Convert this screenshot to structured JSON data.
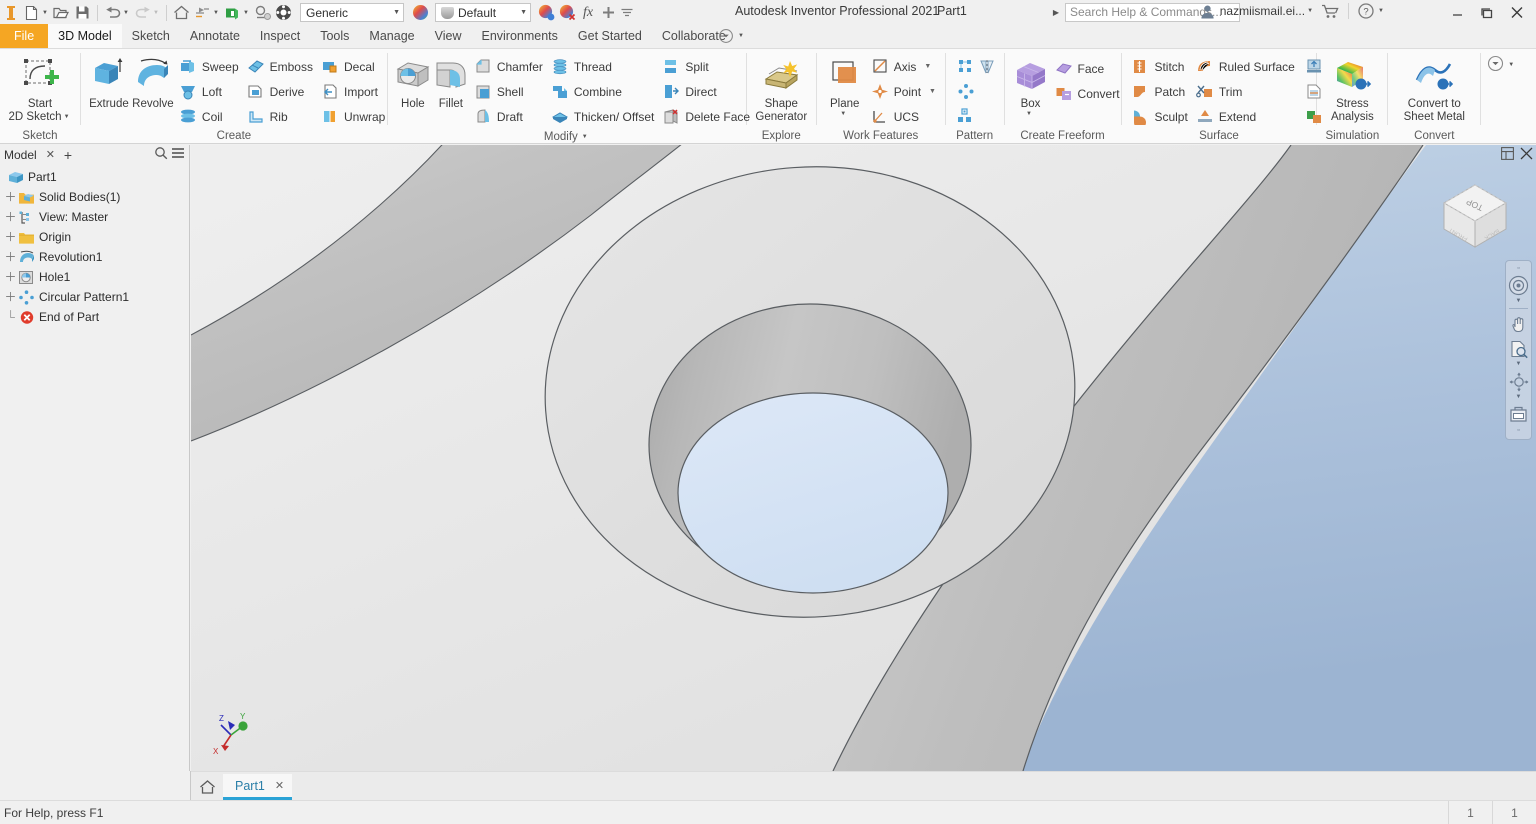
{
  "window": {
    "app_title": "Autodesk Inventor Professional 2021",
    "document_name": "Part1"
  },
  "quick_access": {
    "icons": [
      {
        "name": "inventor-logo-icon",
        "glyph": "I"
      },
      {
        "name": "new-file-icon",
        "glyph": "new"
      },
      {
        "name": "open-folder-icon",
        "glyph": "open"
      },
      {
        "name": "save-icon",
        "glyph": "save"
      },
      {
        "name": "undo-icon",
        "glyph": "undo"
      },
      {
        "name": "redo-icon",
        "glyph": "redo"
      },
      {
        "name": "home-icon",
        "glyph": "home"
      },
      {
        "name": "return-icon",
        "glyph": "return"
      },
      {
        "name": "update-icon",
        "glyph": "update"
      },
      {
        "name": "select-icon",
        "glyph": "select"
      },
      {
        "name": "appearance-wheel-icon",
        "glyph": "wheel"
      }
    ],
    "material_combo": {
      "value": "Generic",
      "placeholder": "Generic"
    },
    "appearance_combo": {
      "value": "Default",
      "placeholder": "Default"
    },
    "after_icons": [
      {
        "name": "adjust-appearance-icon"
      },
      {
        "name": "clear-appearance-icon"
      },
      {
        "name": "parameters-fx-icon",
        "glyph": "fx"
      },
      {
        "name": "add-to-qat-icon",
        "glyph": "+"
      },
      {
        "name": "customize-qat-icon",
        "glyph": "bar"
      }
    ]
  },
  "search": {
    "placeholder": "Search Help & Commands...",
    "value": "Search Help & Commands..."
  },
  "account": {
    "name": "nazmiismail.ei...",
    "cart_icon": "shopping-cart-icon",
    "help_icon": "help-circle-icon"
  },
  "window_controls": {
    "minimize": "–",
    "restore": "❐",
    "close": "✕"
  },
  "ribbon_tabs": [
    {
      "label": "File",
      "kind": "file",
      "active": false
    },
    {
      "label": "3D Model",
      "kind": "normal",
      "active": true
    },
    {
      "label": "Sketch",
      "kind": "normal",
      "active": false
    },
    {
      "label": "Annotate",
      "kind": "normal",
      "active": false
    },
    {
      "label": "Inspect",
      "kind": "normal",
      "active": false
    },
    {
      "label": "Tools",
      "kind": "normal",
      "active": false
    },
    {
      "label": "Manage",
      "kind": "normal",
      "active": false
    },
    {
      "label": "View",
      "kind": "normal",
      "active": false
    },
    {
      "label": "Environments",
      "kind": "normal",
      "active": false
    },
    {
      "label": "Get Started",
      "kind": "normal",
      "active": false
    },
    {
      "label": "Collaborate",
      "kind": "normal",
      "active": false
    }
  ],
  "ribbon": {
    "panels": {
      "sketch": {
        "title": "Sketch",
        "start_2d_sketch": {
          "line1": "Start",
          "line2": "2D Sketch"
        }
      },
      "create": {
        "title": "Create",
        "extrude": "Extrude",
        "revolve": "Revolve",
        "col1": [
          "Sweep",
          "Loft",
          "Coil"
        ],
        "col2": [
          "Emboss",
          "Derive",
          "Rib"
        ],
        "col3": [
          "Decal",
          "Import",
          "Unwrap"
        ]
      },
      "modify": {
        "title": "Modify",
        "hole": "Hole",
        "fillet": "Fillet",
        "col1": [
          "Chamfer",
          "Shell",
          "Draft"
        ],
        "col2": [
          "Thread",
          "Combine",
          "Thicken/ Offset"
        ],
        "col3": [
          "Split",
          "Direct",
          "Delete Face"
        ]
      },
      "explore": {
        "title": "Explore",
        "shape_generator": {
          "line1": "Shape",
          "line2": "Generator"
        }
      },
      "work_features": {
        "title": "Work Features",
        "plane": "Plane",
        "items": [
          {
            "label": "Axis",
            "has_dropdown": true
          },
          {
            "label": "Point",
            "has_dropdown": true
          },
          {
            "label": "UCS",
            "has_dropdown": false
          }
        ]
      },
      "pattern": {
        "title": "Pattern",
        "icons": [
          "rectangular-pattern-icon",
          "mirror-icon",
          "circular-pattern-icon",
          "sketch-driven-pattern-icon"
        ]
      },
      "create_freeform": {
        "title": "Create Freeform",
        "box": "Box",
        "items": [
          "Face",
          "Convert"
        ]
      },
      "surface": {
        "title": "Surface",
        "col1": [
          "Stitch",
          "Patch",
          "Sculpt"
        ],
        "col2": [
          "Ruled Surface",
          "Trim",
          "Extend"
        ],
        "col3_icons": [
          "thicken-surface-icon",
          "boundary-patch-icon",
          "replace-face-icon"
        ]
      },
      "simulation": {
        "title": "Simulation",
        "stress_analysis": {
          "line1": "Stress",
          "line2": "Analysis"
        }
      },
      "convert": {
        "title": "Convert",
        "convert_to_sheet_metal": {
          "line1": "Convert to",
          "line2": "Sheet Metal"
        }
      }
    }
  },
  "browser": {
    "header": {
      "title": "Model",
      "close": "✕",
      "add": "+",
      "search_icon": "search-icon",
      "menu_icon": "hamburger-menu-icon"
    },
    "tree": [
      {
        "label": "Part1",
        "icon": "part-icon",
        "expandable": false,
        "depth": 0
      },
      {
        "label": "Solid Bodies(1)",
        "icon": "solid-bodies-folder-icon",
        "expandable": true,
        "depth": 1
      },
      {
        "label": "View: Master",
        "icon": "view-master-icon",
        "expandable": true,
        "depth": 1
      },
      {
        "label": "Origin",
        "icon": "origin-folder-icon",
        "expandable": true,
        "depth": 1
      },
      {
        "label": "Revolution1",
        "icon": "revolve-feature-icon",
        "expandable": true,
        "depth": 1
      },
      {
        "label": "Hole1",
        "icon": "hole-feature-icon",
        "expandable": true,
        "depth": 1
      },
      {
        "label": "Circular Pattern1",
        "icon": "circular-pattern-feature-icon",
        "expandable": true,
        "depth": 1
      },
      {
        "label": "End of Part",
        "icon": "end-of-part-icon",
        "expandable": false,
        "depth": 1
      }
    ]
  },
  "viewport": {
    "view_orientation": "Top",
    "viewcube_faces": {
      "top": "TOP",
      "front": "FRONT",
      "back": "BACK"
    },
    "top_right_controls": [
      {
        "name": "viewport-layout-icon"
      },
      {
        "name": "viewport-close-icon",
        "glyph": "✕"
      }
    ],
    "navigation_bar": [
      {
        "name": "full-navigation-wheel-icon",
        "has_caret": true
      },
      {
        "name": "pan-hand-icon",
        "has_caret": false
      },
      {
        "name": "zoom-window-icon",
        "has_caret": true
      },
      {
        "name": "orbit-icon",
        "has_caret": true
      },
      {
        "name": "look-at-icon",
        "has_caret": false
      }
    ],
    "axis_labels": {
      "x": "X",
      "y": "Y",
      "z": "Z"
    },
    "colors": {
      "background_top": "#efefef",
      "background_bottom": "#e3e3e3",
      "part_light": "#e6e6e6",
      "part_mid": "#c9c9c9",
      "part_dark": "#b7b7b7",
      "hole_bottom_blue": "#d6e4f5",
      "sky_blue": "#aec3dd",
      "edge": "#54585c"
    }
  },
  "document_tabs": {
    "home_icon": "home-icon",
    "tabs": [
      {
        "label": "Part1",
        "active": true,
        "close": "✕"
      }
    ]
  },
  "status_bar": {
    "message": "For Help, press F1",
    "cells": [
      "1",
      "1"
    ]
  }
}
